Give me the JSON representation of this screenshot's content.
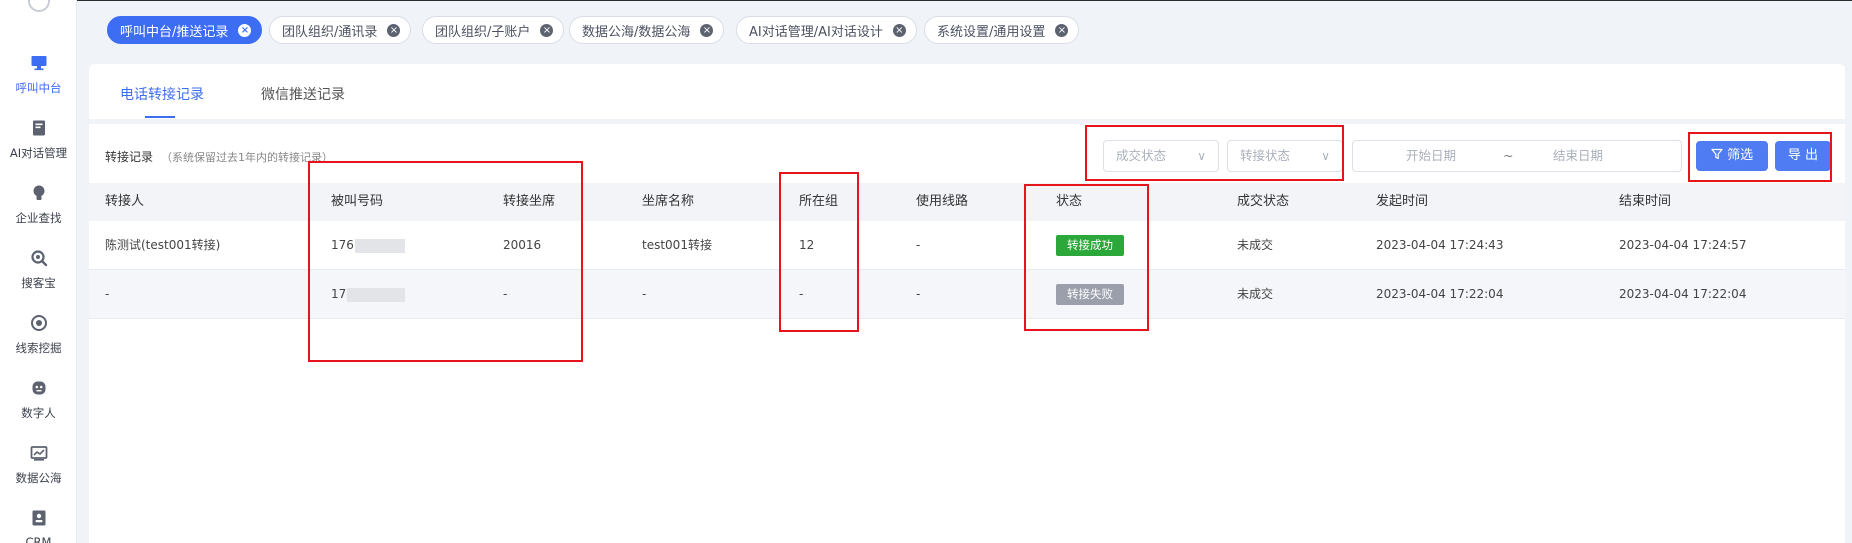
{
  "sidebar": {
    "items": [
      {
        "label": "呼叫中台",
        "icon": "monitor-icon"
      },
      {
        "label": "AI对话管理",
        "icon": "book-icon"
      },
      {
        "label": "企业查找",
        "icon": "bulb-icon"
      },
      {
        "label": "搜客宝",
        "icon": "search-icon"
      },
      {
        "label": "线索挖掘",
        "icon": "target-icon"
      },
      {
        "label": "数字人",
        "icon": "robot-icon"
      },
      {
        "label": "数据公海",
        "icon": "chart-icon"
      },
      {
        "label": "CRM",
        "icon": "contact-icon"
      }
    ],
    "active_index": 0
  },
  "tags": [
    {
      "label": "呼叫中台/推送记录"
    },
    {
      "label": "团队组织/通讯录"
    },
    {
      "label": "团队组织/子账户"
    },
    {
      "label": "数据公海/数据公海"
    },
    {
      "label": "AI对话管理/AI对话设计"
    },
    {
      "label": "系统设置/通用设置"
    }
  ],
  "subtabs": [
    {
      "label": "电话转接记录"
    },
    {
      "label": "微信推送记录"
    }
  ],
  "records": {
    "title": "转接记录",
    "note": "（系统保留过去1年内的转接记录）"
  },
  "filters": {
    "deal_status_placeholder": "成交状态",
    "transfer_status_placeholder": "转接状态",
    "start_date_placeholder": "开始日期",
    "range_separator": "~",
    "end_date_placeholder": "结束日期",
    "filter_button": "筛选",
    "export_button": "导 出"
  },
  "table": {
    "columns": [
      "转接人",
      "被叫号码",
      "转接坐席",
      "坐席名称",
      "所在组",
      "使用线路",
      "状态",
      "成交状态",
      "发起时间",
      "结束时间"
    ],
    "rows": [
      {
        "transferer": "陈测试(test001转接)",
        "callee": "176",
        "seat": "20016",
        "seat_name": "test001转接",
        "group": "12",
        "line": "-",
        "status": "转接成功",
        "deal_status": "未成交",
        "start_time": "2023-04-04 17:24:43",
        "end_time": "2023-04-04 17:24:57"
      },
      {
        "transferer": "-",
        "callee": "17",
        "seat": "-",
        "seat_name": "-",
        "group": "-",
        "line": "-",
        "status": "转接失败",
        "deal_status": "未成交",
        "start_time": "2023-04-04 17:22:04",
        "end_time": "2023-04-04 17:22:04"
      }
    ]
  },
  "colors": {
    "accent": "#3d6df2",
    "success": "#2ba839",
    "fail": "#9a9fab",
    "highlight": "#e8141b"
  }
}
